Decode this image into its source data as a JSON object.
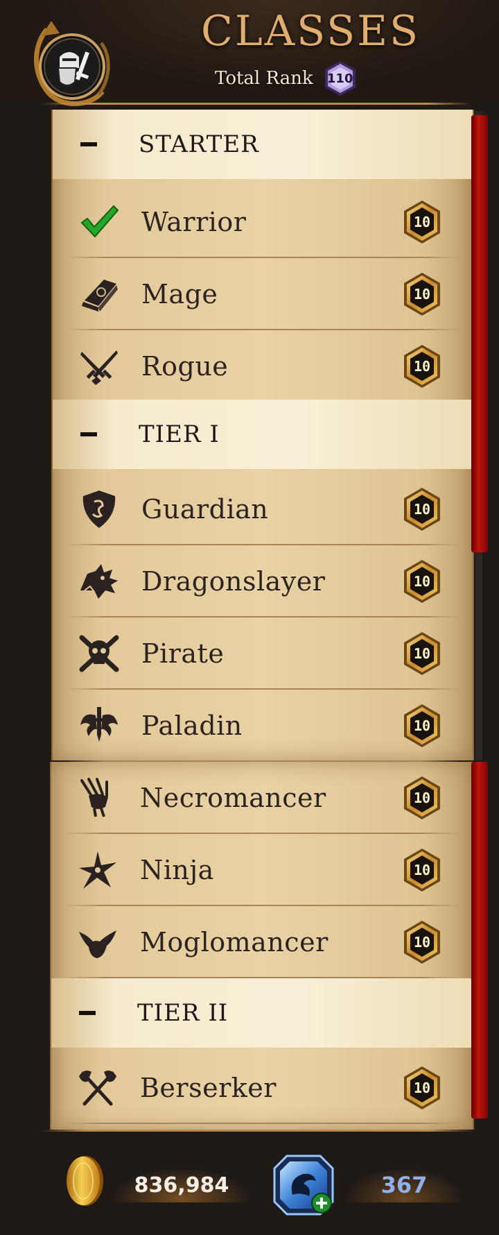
{
  "header": {
    "title": "Classes",
    "title_display": "CLASSES",
    "total_rank_label": "Total Rank",
    "total_rank_value": "110",
    "emblem_icon": "knight-helmet-shield-icon"
  },
  "classes_list": {
    "sections": [
      {
        "title": "STARTER",
        "collapse_icon": "minus-icon",
        "items": [
          {
            "name": "Warrior",
            "icon": "checkmark-icon",
            "rank": "10",
            "selected": true
          },
          {
            "name": "Mage",
            "icon": "spellbook-icon",
            "rank": "10"
          },
          {
            "name": "Rogue",
            "icon": "crossed-daggers-icon",
            "rank": "10"
          }
        ]
      },
      {
        "title": "TIER I",
        "collapse_icon": "minus-icon",
        "items": [
          {
            "name": "Guardian",
            "icon": "dragon-shield-icon",
            "rank": "10"
          },
          {
            "name": "Dragonslayer",
            "icon": "dragon-head-icon",
            "rank": "10"
          },
          {
            "name": "Pirate",
            "icon": "skull-crossbones-icon",
            "rank": "10"
          },
          {
            "name": "Paladin",
            "icon": "winged-sword-icon",
            "rank": "10"
          },
          {
            "name": "Necromancer",
            "icon": "skeletal-hand-icon",
            "rank": "10"
          },
          {
            "name": "Ninja",
            "icon": "shuriken-icon",
            "rank": "10"
          },
          {
            "name": "Moglomancer",
            "icon": "mogloween-ears-icon",
            "rank": "10"
          }
        ]
      },
      {
        "title": "TIER II",
        "collapse_icon": "minus-icon",
        "items": [
          {
            "name": "Berserker",
            "icon": "crossed-axes-icon",
            "rank": "10"
          }
        ]
      }
    ]
  },
  "footer": {
    "gold": "836,984",
    "gold_icon": "gold-coin-icon",
    "dragon_amulet": "367",
    "dragon_amulet_icon": "dragon-gem-icon",
    "add_icon": "plus-icon"
  },
  "colors": {
    "title_gold": "#e0ad6e",
    "rank_badge": "#b39be0",
    "parchment": "#e8d2a6",
    "section_band": "#f8efd7",
    "scroll_thumb": "#c0140c",
    "badge_gold": "#e3b65a",
    "gem_blue": "#8fb0e8",
    "check_green": "#26a52a"
  }
}
